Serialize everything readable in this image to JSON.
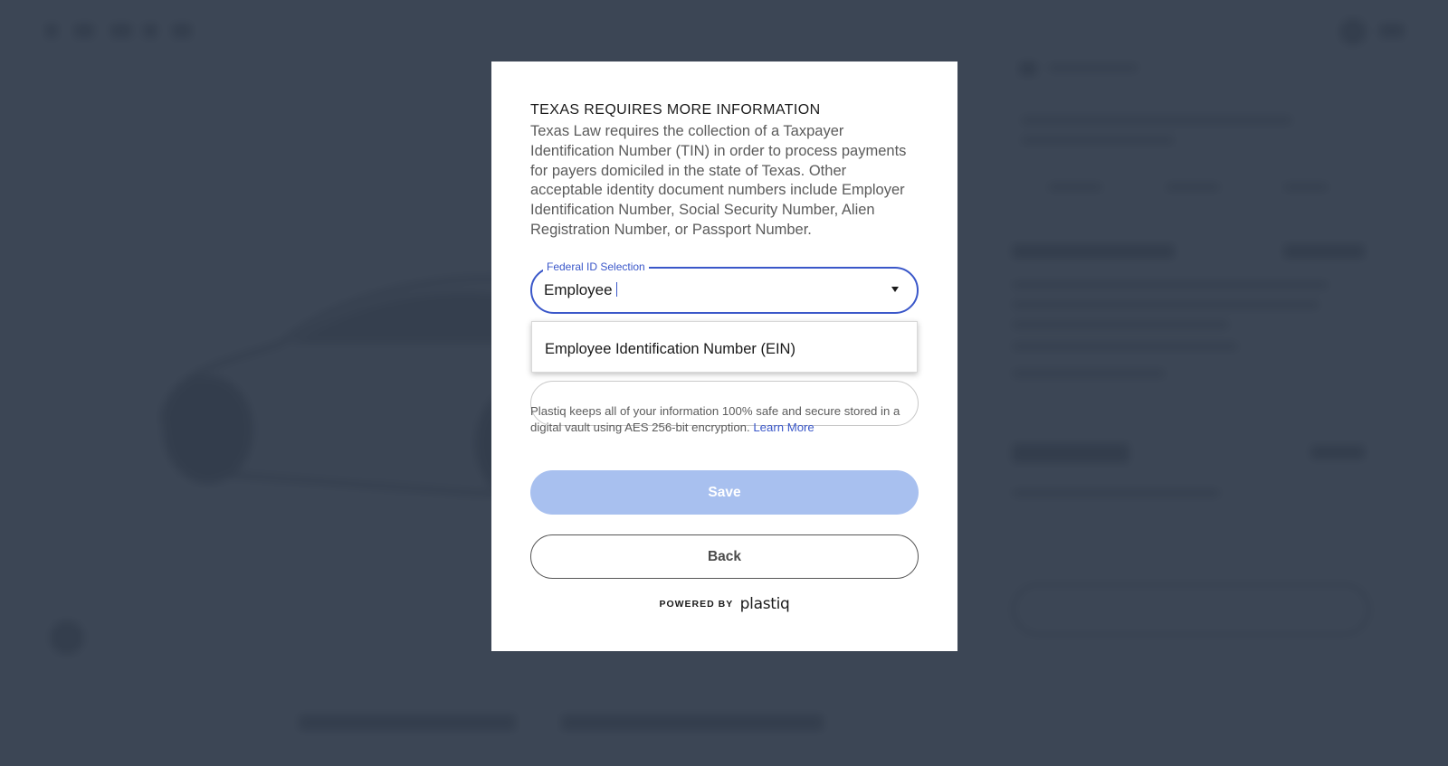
{
  "modal": {
    "title": "TEXAS REQUIRES MORE INFORMATION",
    "description": "Texas Law requires the collection of a Taxpayer Identification Number (TIN) in order to process payments for payers domiciled in the state of Texas. Other acceptable identity document numbers include Employer Identification Number, Social Security Number, Alien Registration Number, or Passport Number.",
    "federal_id": {
      "label": "Federal ID Selection",
      "value": "Employee",
      "options": [
        "Employee Identification Number (EIN)"
      ]
    },
    "secure_note": "Plastiq keeps all of your information 100% safe and secure stored in a digital vault using AES 256-bit encryption.",
    "learn_more_label": "Learn More",
    "save_label": "Save",
    "back_label": "Back",
    "powered_by": "POWERED BY",
    "brand": "plastiq"
  },
  "colors": {
    "accent": "#3a57c9",
    "save_disabled": "#a8c0ef",
    "overlay": "#343e4e"
  }
}
